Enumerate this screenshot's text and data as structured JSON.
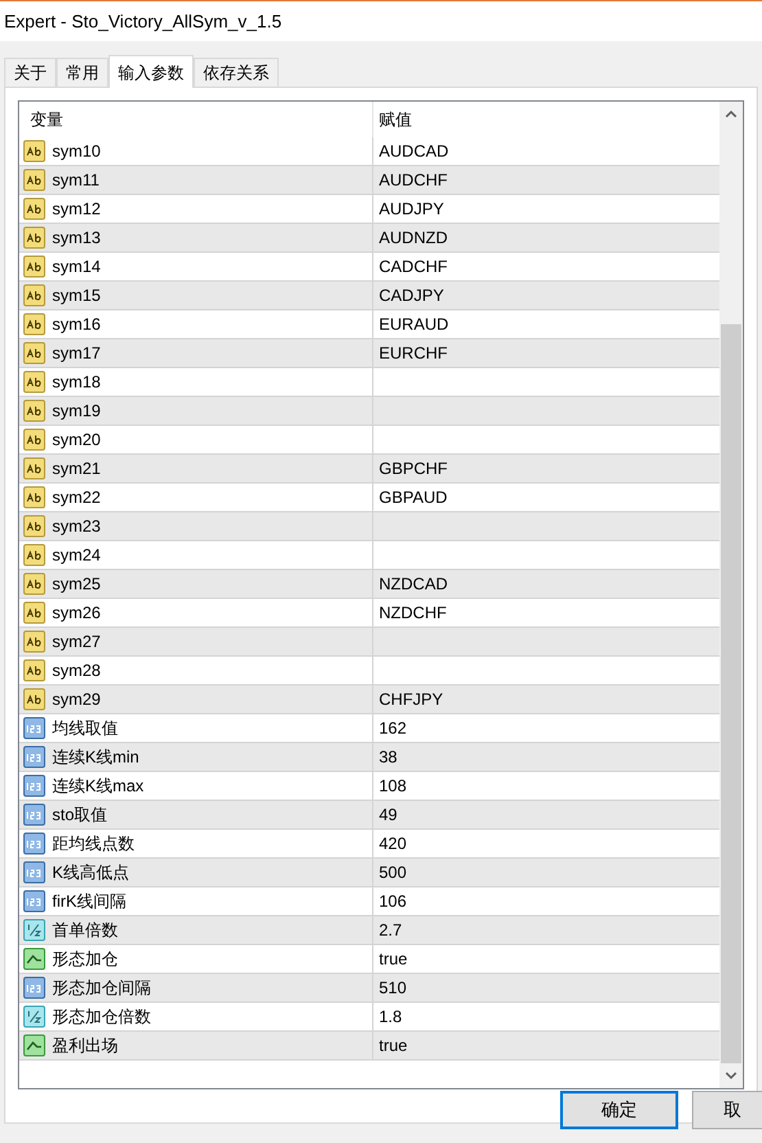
{
  "window": {
    "title": "Expert - Sto_Victory_AllSym_v_1.5"
  },
  "tabs": [
    {
      "label": "关于",
      "selected": false
    },
    {
      "label": "常用",
      "selected": false
    },
    {
      "label": "输入参数",
      "selected": true
    },
    {
      "label": "依存关系",
      "selected": false
    }
  ],
  "table": {
    "columns": [
      "变量",
      "赋值"
    ],
    "rows": [
      {
        "kind": "string",
        "name": "sym10",
        "value": "AUDCAD"
      },
      {
        "kind": "string",
        "name": "sym11",
        "value": "AUDCHF"
      },
      {
        "kind": "string",
        "name": "sym12",
        "value": "AUDJPY"
      },
      {
        "kind": "string",
        "name": "sym13",
        "value": "AUDNZD"
      },
      {
        "kind": "string",
        "name": "sym14",
        "value": "CADCHF"
      },
      {
        "kind": "string",
        "name": "sym15",
        "value": "CADJPY"
      },
      {
        "kind": "string",
        "name": "sym16",
        "value": "EURAUD"
      },
      {
        "kind": "string",
        "name": "sym17",
        "value": "EURCHF"
      },
      {
        "kind": "string",
        "name": "sym18"
      },
      {
        "kind": "string",
        "name": "sym19"
      },
      {
        "kind": "string",
        "name": "sym20"
      },
      {
        "kind": "string",
        "name": "sym21",
        "value": "GBPCHF"
      },
      {
        "kind": "string",
        "name": "sym22",
        "value": "GBPAUD"
      },
      {
        "kind": "string",
        "name": "sym23"
      },
      {
        "kind": "string",
        "name": "sym24"
      },
      {
        "kind": "string",
        "name": "sym25",
        "value": "NZDCAD"
      },
      {
        "kind": "string",
        "name": "sym26",
        "value": "NZDCHF"
      },
      {
        "kind": "string",
        "name": "sym27"
      },
      {
        "kind": "string",
        "name": "sym28"
      },
      {
        "kind": "string",
        "name": "sym29",
        "value": "CHFJPY"
      },
      {
        "kind": "int",
        "name": "均线取值",
        "value": "162"
      },
      {
        "kind": "int",
        "name": "连续K线min",
        "value": "38"
      },
      {
        "kind": "int",
        "name": "连续K线max",
        "value": "108"
      },
      {
        "kind": "int",
        "name": "sto取值",
        "value": "49"
      },
      {
        "kind": "int",
        "name": "距均线点数",
        "value": "420"
      },
      {
        "kind": "int",
        "name": "K线高低点",
        "value": "500"
      },
      {
        "kind": "int",
        "name": "firK线间隔",
        "value": "106"
      },
      {
        "kind": "double",
        "name": "首单倍数",
        "value": "2.7"
      },
      {
        "kind": "bool",
        "name": "形态加仓",
        "value": "true"
      },
      {
        "kind": "int",
        "name": "形态加仓间隔",
        "value": "510"
      },
      {
        "kind": "double",
        "name": "形态加仓倍数",
        "value": "1.8"
      },
      {
        "kind": "bool",
        "name": "盈利出场",
        "value": "true"
      }
    ]
  },
  "buttons": [
    {
      "label": "确定",
      "selected": true
    },
    {
      "label": "取",
      "selected": false
    }
  ]
}
